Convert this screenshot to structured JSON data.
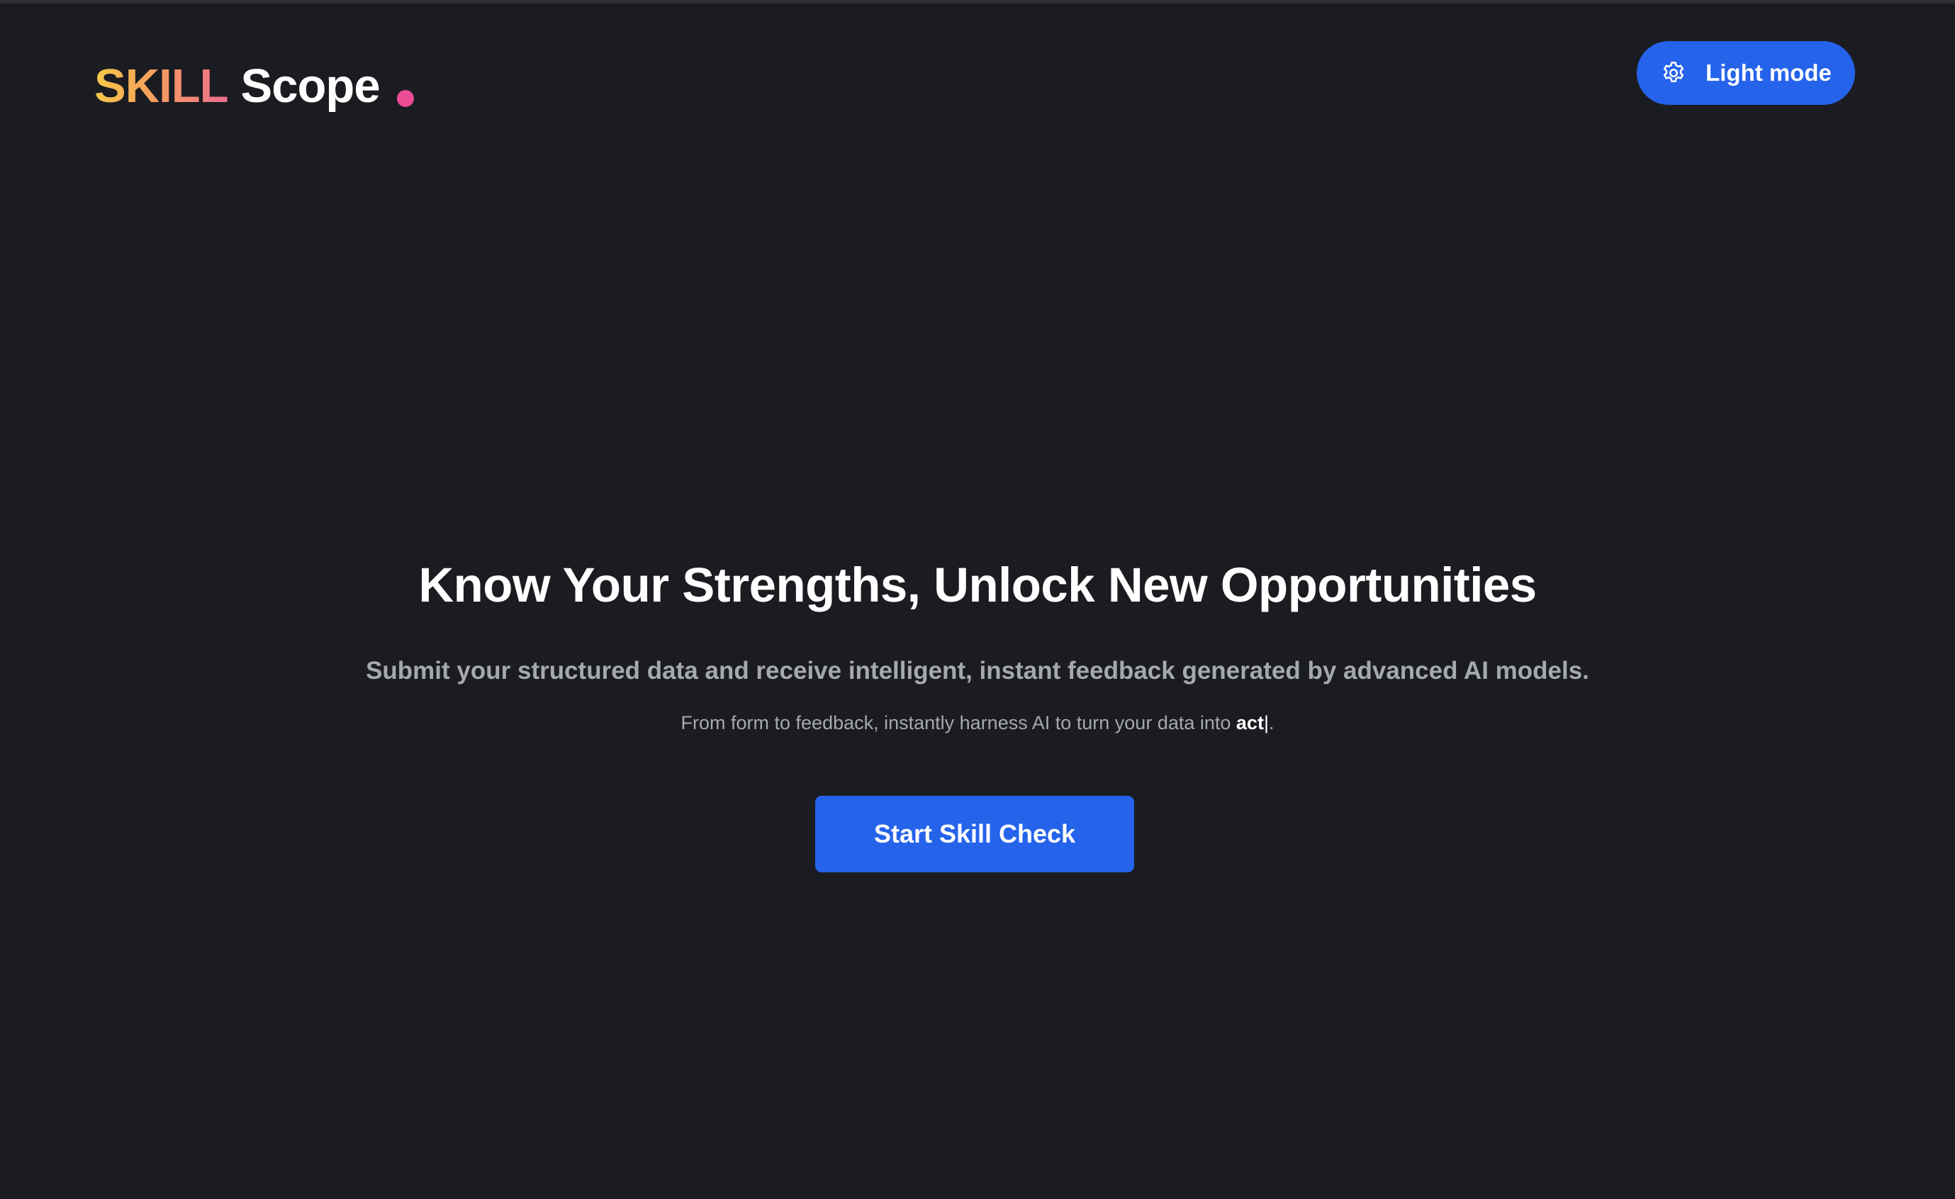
{
  "header": {
    "logo": {
      "part1": "SKILL",
      "part2": "Scope"
    },
    "theme_toggle": {
      "label": "Light mode",
      "icon": "gear-icon"
    }
  },
  "hero": {
    "title": "Know Your Strengths, Unlock New Opportunities",
    "subtitle": "Submit your structured data and receive intelligent, instant feedback generated by advanced AI models.",
    "tagline_prefix": "From form to feedback, instantly harness AI to turn your data into ",
    "tagline_typed": "act",
    "tagline_caret": "|",
    "tagline_suffix": ".",
    "cta_label": "Start Skill Check"
  },
  "colors": {
    "background": "#1b1c21",
    "accent": "#2563eb",
    "logo_dot": "#ec4c93",
    "logo_gradient_start": "#f7c84a",
    "logo_gradient_end": "#ef6d8f",
    "muted_text": "#a6a8b0"
  }
}
